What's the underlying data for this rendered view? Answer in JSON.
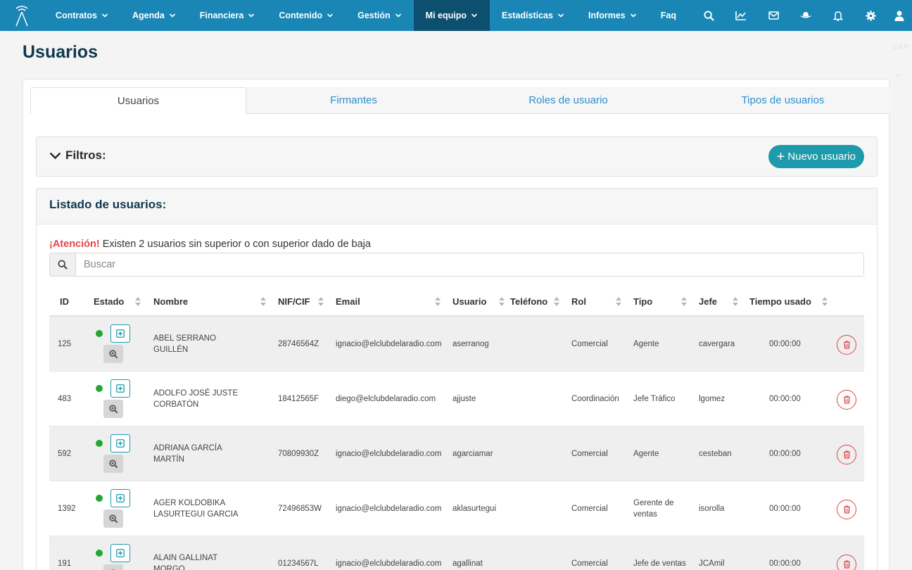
{
  "nav": {
    "items": [
      {
        "label": "Contratos",
        "caret": true,
        "active": false
      },
      {
        "label": "Agenda",
        "caret": true,
        "active": false
      },
      {
        "label": "Financiera",
        "caret": true,
        "active": false
      },
      {
        "label": "Contenido",
        "caret": true,
        "active": false
      },
      {
        "label": "Gestión",
        "caret": true,
        "active": false
      },
      {
        "label": "Mi equipo",
        "caret": true,
        "active": true
      },
      {
        "label": "Estadísticas",
        "caret": true,
        "active": false
      },
      {
        "label": "Informes",
        "caret": true,
        "active": false
      },
      {
        "label": "Faq",
        "caret": false,
        "active": false
      }
    ],
    "icons": [
      "search-icon",
      "chart-line-icon",
      "mail-icon",
      "cowboy-hat-icon",
      "bell-icon",
      "gear-icon",
      "user-icon"
    ],
    "colors": {
      "bar": "#1a86b5",
      "active": "#0d4f6f"
    }
  },
  "page": {
    "title": "Usuarios",
    "ghost": "CAP"
  },
  "tabs": [
    {
      "label": "Usuarios",
      "active": true
    },
    {
      "label": "Firmantes",
      "active": false
    },
    {
      "label": "Roles de usuario",
      "active": false
    },
    {
      "label": "Tipos de usuarios",
      "active": false
    }
  ],
  "filters": {
    "title": "Filtros:",
    "new_button": "Nuevo usuario"
  },
  "list": {
    "title": "Listado de usuarios:",
    "alert_strong": "¡Atención!",
    "alert_text": " Existen 2 usuarios sin superior o con superior dado de baja",
    "search_placeholder": "Buscar"
  },
  "columns": [
    "ID",
    "Estado",
    "Nombre",
    "NIF/CIF",
    "Email",
    "Usuario",
    "Teléfono",
    "Rol",
    "Tipo",
    "Jefe",
    "Tiempo usado"
  ],
  "rows": [
    {
      "id": "125",
      "name": "ABEL SERRANO GUILLÉN",
      "nif": "28746564Z",
      "email": "ignacio@elclubdelaradio.com",
      "user": "aserranog",
      "phone": "",
      "role": "Comercial",
      "type": "Agente",
      "boss": "cavergara",
      "time": "00:00:00"
    },
    {
      "id": "483",
      "name": "ADOLFO JOSÉ JUSTE CORBATÓN",
      "nif": "18412565F",
      "email": "diego@elclubdelaradio.com",
      "user": "ajjuste",
      "phone": "",
      "role": "Coordinación",
      "type": "Jefe Tráfico",
      "boss": "lgomez",
      "time": "00:00:00"
    },
    {
      "id": "592",
      "name": "ADRIANA GARCÍA MARTÍN",
      "nif": "70809930Z",
      "email": "ignacio@elclubdelaradio.com",
      "user": "agarciamar",
      "phone": "",
      "role": "Comercial",
      "type": "Agente",
      "boss": "cesteban",
      "time": "00:00:00"
    },
    {
      "id": "1392",
      "name": "AGER KOLDOBIKA LASURTEGUI GARCIA",
      "nif": "72496853W",
      "email": "ignacio@elclubdelaradio.com",
      "user": "aklasurtegui",
      "phone": "",
      "role": "Comercial",
      "type": "Gerente de ventas",
      "boss": "isorolla",
      "time": "00:00:00"
    },
    {
      "id": "191",
      "name": "ALAIN GALLINAT MORGO",
      "nif": "01234567L",
      "email": "ignacio@elclubdelaradio.com",
      "user": "agallinat",
      "phone": "",
      "role": "Comercial",
      "type": "Jefe de ventas",
      "boss": "JCAmil",
      "time": "00:00:00"
    }
  ]
}
